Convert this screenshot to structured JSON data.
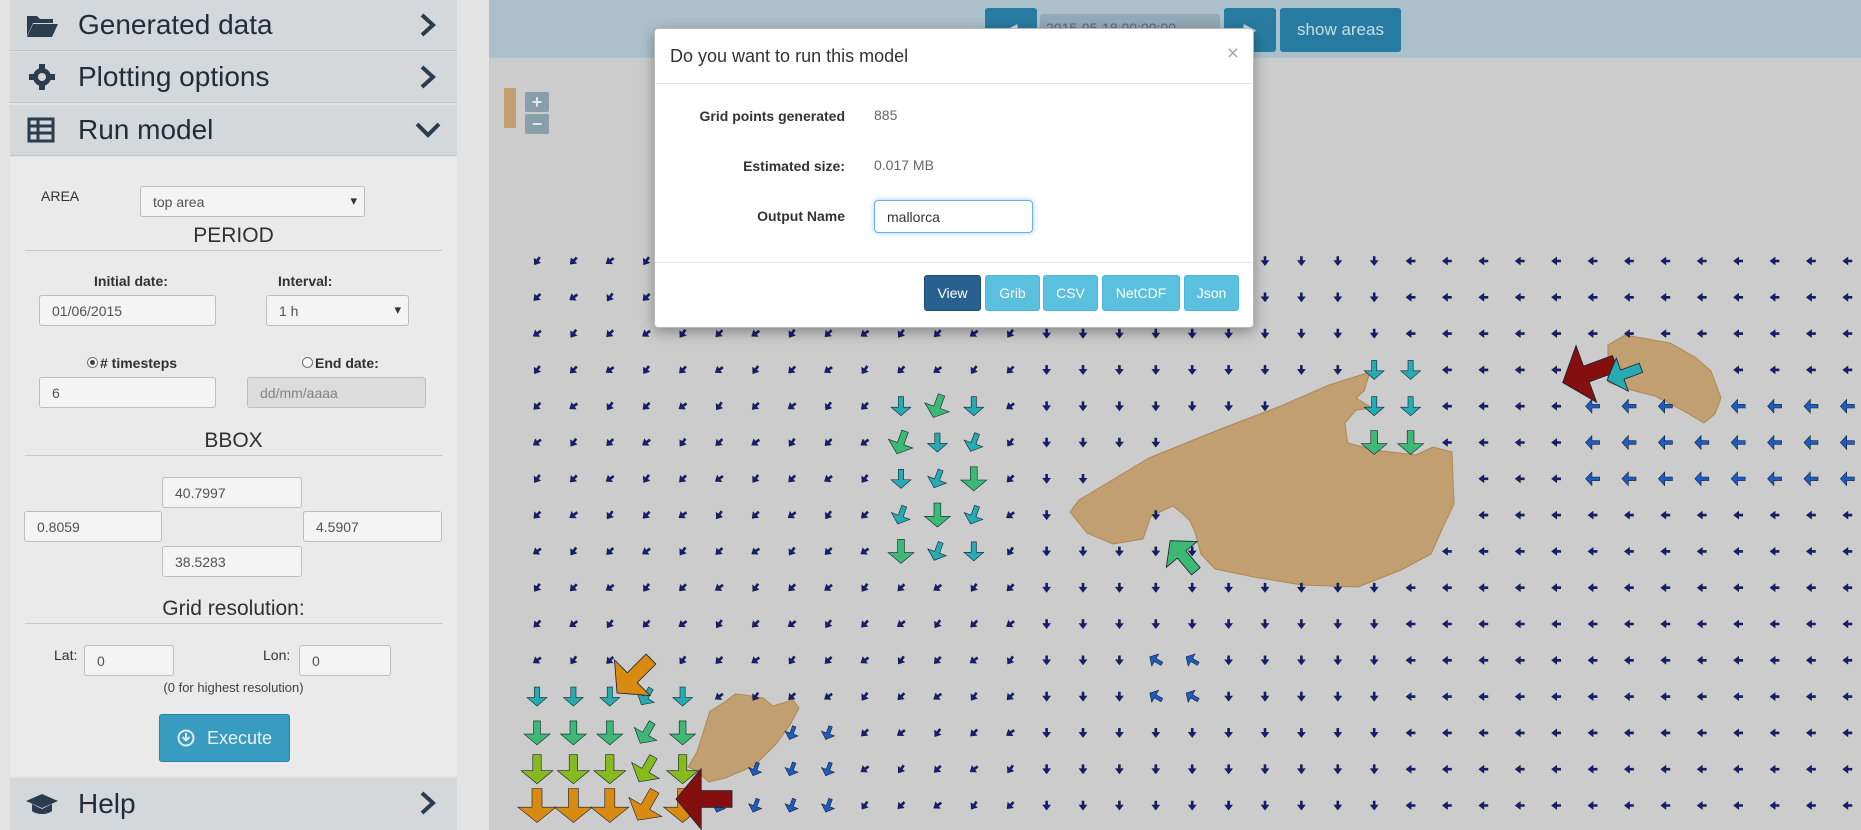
{
  "sidebar": {
    "generated_data_label": "Generated data",
    "plotting_options_label": "Plotting options",
    "run_model_label": "Run model",
    "help_label": "Help",
    "area_label": "AREA",
    "area_value": "top area",
    "period_title": "PERIOD",
    "initial_date_label": "Initial date:",
    "initial_date_value": "01/06/2015",
    "interval_label": "Interval:",
    "interval_value": "1 h",
    "timesteps_label": "# timesteps",
    "timesteps_value": "6",
    "end_date_label": "End date:",
    "end_date_placeholder": "dd/mm/aaaa",
    "bbox_title": "BBOX",
    "bbox_north": "40.7997",
    "bbox_west": "0.8059",
    "bbox_east": "4.5907",
    "bbox_south": "38.5283",
    "grid_resolution_title": "Grid resolution:",
    "lat_label": "Lat:",
    "lat_value": "0",
    "lon_label": "Lon:",
    "lon_value": "0",
    "resolution_hint": "(0 for highest resolution)",
    "execute_label": "Execute"
  },
  "topbar": {
    "datetime_value": "2015-05-18 00:00:00",
    "show_areas_label": "show areas"
  },
  "modal": {
    "title": "Do you want to run this model",
    "close_glyph": "×",
    "grid_points_label": "Grid points generated",
    "grid_points_value": "885",
    "estimated_size_label": "Estimated size:",
    "estimated_size_value": "0.017 MB",
    "output_name_label": "Output Name",
    "output_name_value": "mallorca",
    "buttons": {
      "view": "View",
      "grib": "Grib",
      "csv": "CSV",
      "netcdf": "NetCDF",
      "json": "Json"
    }
  },
  "colors": {
    "accent": "#286090",
    "info": "#5bc0de",
    "land": "#c9a574",
    "arrow_weak": "#1a1a8c"
  },
  "icons": [
    "folder-open-icon",
    "gear-icon",
    "table-icon",
    "chevron-right-icon",
    "chevron-down-icon",
    "graduation-cap-icon",
    "download-icon",
    "close-icon"
  ]
}
